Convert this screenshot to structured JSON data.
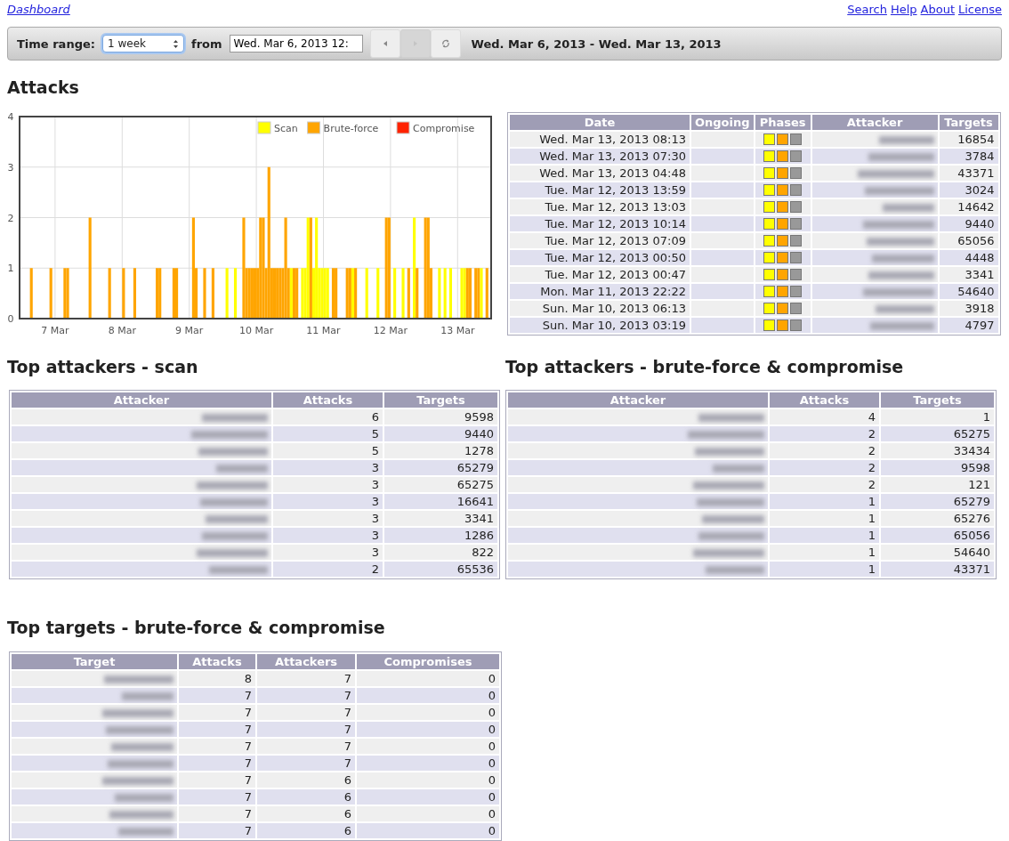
{
  "top_links": {
    "home": "Dashboard",
    "right": [
      "Search",
      "Help",
      "About",
      "License"
    ]
  },
  "toolbar": {
    "time_range_label": "Time range:",
    "time_range_value": "1 week",
    "from_label": "from",
    "from_value": "Wed. Mar 6, 2013 12:",
    "range_text": "Wed. Mar 6, 2013 - Wed. Mar 13, 2013",
    "buttons": [
      {
        "kind": "prev",
        "disabled": false
      },
      {
        "kind": "next",
        "disabled": true
      },
      {
        "kind": "refresh",
        "disabled": false
      }
    ]
  },
  "attacks": {
    "title": "Attacks",
    "chart_data": {
      "type": "bar",
      "grid": true,
      "legend": "upper right",
      "ylim": [
        0,
        4
      ],
      "yticks": [
        0,
        1,
        2,
        3,
        4
      ],
      "categories": [
        null,
        null,
        null,
        null,
        null,
        null,
        null,
        null,
        null,
        null,
        null,
        null,
        "7 Mar",
        null,
        null,
        null,
        null,
        null,
        null,
        null,
        null,
        null,
        null,
        null,
        null,
        null,
        null,
        null,
        null,
        null,
        null,
        null,
        null,
        null,
        null,
        null,
        "8 Mar",
        null,
        null,
        null,
        null,
        null,
        null,
        null,
        null,
        null,
        null,
        null,
        null,
        null,
        null,
        null,
        null,
        null,
        null,
        null,
        null,
        null,
        null,
        null,
        "9 Mar",
        null,
        null,
        null,
        null,
        null,
        null,
        null,
        null,
        null,
        null,
        null,
        null,
        null,
        null,
        null,
        null,
        null,
        null,
        null,
        null,
        null,
        null,
        null,
        "10 Mar",
        null,
        null,
        null,
        null,
        null,
        null,
        null,
        null,
        null,
        null,
        null,
        null,
        null,
        null,
        null,
        null,
        null,
        null,
        null,
        null,
        null,
        null,
        null,
        "11 Mar",
        null,
        null,
        null,
        null,
        null,
        null,
        null,
        null,
        null,
        null,
        null,
        null,
        null,
        null,
        null,
        null,
        null,
        null,
        null,
        null,
        null,
        null,
        null,
        "12 Mar",
        null,
        null,
        null,
        null,
        null,
        null,
        null,
        null,
        null,
        null,
        null,
        null,
        null,
        null,
        null,
        null,
        null,
        null,
        null,
        null,
        null,
        null,
        null,
        "13 Mar",
        null,
        null,
        null,
        null,
        null,
        null,
        null,
        null,
        null,
        null,
        null
      ],
      "series": [
        {
          "name": "Scan",
          "color": "#ffff00",
          "values": [
            0,
            0,
            0,
            0,
            0,
            0,
            0,
            0,
            0,
            0,
            0,
            0,
            0,
            0,
            0,
            0,
            0,
            0,
            0,
            0,
            0,
            0,
            0,
            0,
            0,
            0,
            0,
            0,
            0,
            0,
            0,
            0,
            0,
            0,
            0,
            0,
            0,
            0,
            0,
            0,
            0,
            0,
            0,
            0,
            0,
            0,
            0,
            0,
            0,
            0,
            0,
            0,
            0,
            0,
            0,
            0,
            0,
            0,
            0,
            0,
            0,
            0,
            0,
            0,
            0,
            0,
            0,
            0,
            0,
            0,
            0,
            0,
            0,
            1,
            0,
            0,
            1,
            0,
            0,
            0,
            0,
            0,
            0,
            0,
            0,
            0,
            0,
            0,
            0,
            0,
            0,
            0,
            0,
            0,
            0,
            0,
            1,
            0,
            0,
            0,
            1,
            1,
            2,
            0,
            1,
            2,
            1,
            1,
            1,
            1,
            0,
            0,
            0,
            0,
            0,
            0,
            0,
            0,
            1,
            0,
            0,
            0,
            0,
            1,
            0,
            0,
            0,
            1,
            0,
            0,
            0,
            0,
            0,
            1,
            0,
            0,
            1,
            0,
            0,
            0,
            2,
            0,
            0,
            0,
            0,
            0,
            0,
            0,
            0,
            1,
            0,
            1,
            0,
            1,
            0,
            0,
            0,
            1,
            1,
            0,
            0,
            0,
            0,
            0,
            1,
            0,
            0,
            0
          ]
        },
        {
          "name": "Brute-force",
          "color": "#ffa500",
          "values": [
            0,
            0,
            0,
            1,
            0,
            0,
            0,
            0,
            0,
            0,
            1,
            0,
            0,
            0,
            0,
            1,
            1,
            0,
            0,
            0,
            0,
            0,
            0,
            0,
            2,
            0,
            0,
            0,
            0,
            0,
            0,
            1,
            0,
            0,
            0,
            0,
            1,
            0,
            0,
            0,
            1,
            0,
            0,
            0,
            0,
            0,
            0,
            0,
            1,
            1,
            0,
            0,
            0,
            0,
            1,
            1,
            0,
            0,
            0,
            0,
            0,
            2,
            1,
            0,
            0,
            1,
            0,
            0,
            1,
            0,
            0,
            0,
            0,
            0,
            0,
            0,
            0,
            0,
            0,
            2,
            1,
            1,
            1,
            1,
            1,
            2,
            2,
            1,
            3,
            1,
            1,
            1,
            1,
            1,
            2,
            1,
            0,
            1,
            1,
            0,
            0,
            0,
            0,
            2,
            0,
            0,
            0,
            0,
            0,
            0,
            0,
            1,
            1,
            0,
            0,
            0,
            1,
            1,
            0,
            1,
            0,
            0,
            0,
            0,
            0,
            0,
            0,
            0,
            0,
            0,
            2,
            2,
            0,
            0,
            0,
            0,
            0,
            0,
            1,
            0,
            0,
            1,
            0,
            0,
            2,
            2,
            1,
            0,
            0,
            0,
            0,
            0,
            0,
            0,
            0,
            0,
            0,
            0,
            0,
            1,
            1,
            0,
            1,
            1,
            0,
            0,
            1,
            0
          ]
        },
        {
          "name": "Compromise",
          "color": "#ff2200",
          "values": [
            0,
            0,
            0,
            0,
            0,
            0,
            0,
            0,
            0,
            0,
            0,
            0,
            0,
            0,
            0,
            0,
            0,
            0,
            0,
            0,
            0,
            0,
            0,
            0,
            0,
            0,
            0,
            0,
            0,
            0,
            0,
            0,
            0,
            0,
            0,
            0,
            0,
            0,
            0,
            0,
            0,
            0,
            0,
            0,
            0,
            0,
            0,
            0,
            0,
            0,
            0,
            0,
            0,
            0,
            0,
            0,
            0,
            0,
            0,
            0,
            0,
            0,
            0,
            0,
            0,
            0,
            0,
            0,
            0,
            0,
            0,
            0,
            0,
            0,
            0,
            0,
            0,
            0,
            0,
            0,
            0,
            0,
            0,
            0,
            0,
            0,
            0,
            0,
            0,
            0,
            0,
            0,
            0,
            0,
            0,
            0,
            0,
            0,
            0,
            0,
            0,
            0,
            0,
            0,
            0,
            0,
            0,
            0,
            0,
            0,
            0,
            0,
            0,
            0,
            0,
            0,
            0,
            0,
            0,
            0,
            0,
            0,
            0,
            0,
            0,
            0,
            0,
            0,
            0,
            0,
            0,
            0,
            0,
            0,
            0,
            0,
            0,
            0,
            0,
            0,
            0,
            0,
            0,
            0,
            0,
            0,
            0,
            0,
            0,
            0,
            0,
            0,
            0,
            0,
            0,
            0,
            0,
            0,
            0,
            0,
            0,
            0,
            0,
            0,
            0,
            0,
            0,
            0
          ]
        }
      ]
    },
    "recent": {
      "columns": [
        "Date",
        "Ongoing",
        "Phases",
        "Attacker",
        "Targets"
      ],
      "rows": [
        {
          "date": "Wed. Mar 13, 2013 08:13",
          "phases": {
            "scan": true,
            "brute_force": true,
            "compromise": false
          },
          "targets": "16854"
        },
        {
          "date": "Wed. Mar 13, 2013 07:30",
          "phases": {
            "scan": true,
            "brute_force": true,
            "compromise": false
          },
          "targets": "3784"
        },
        {
          "date": "Wed. Mar 13, 2013 04:48",
          "phases": {
            "scan": true,
            "brute_force": true,
            "compromise": false
          },
          "targets": "43371"
        },
        {
          "date": "Tue. Mar 12, 2013 13:59",
          "phases": {
            "scan": true,
            "brute_force": true,
            "compromise": false
          },
          "targets": "3024"
        },
        {
          "date": "Tue. Mar 12, 2013 13:03",
          "phases": {
            "scan": true,
            "brute_force": true,
            "compromise": false
          },
          "targets": "14642"
        },
        {
          "date": "Tue. Mar 12, 2013 10:14",
          "phases": {
            "scan": true,
            "brute_force": true,
            "compromise": false
          },
          "targets": "9440"
        },
        {
          "date": "Tue. Mar 12, 2013 07:09",
          "phases": {
            "scan": true,
            "brute_force": true,
            "compromise": false
          },
          "targets": "65056"
        },
        {
          "date": "Tue. Mar 12, 2013 00:50",
          "phases": {
            "scan": true,
            "brute_force": true,
            "compromise": false
          },
          "targets": "4448"
        },
        {
          "date": "Tue. Mar 12, 2013 00:47",
          "phases": {
            "scan": true,
            "brute_force": true,
            "compromise": false
          },
          "targets": "3341"
        },
        {
          "date": "Mon. Mar 11, 2013 22:22",
          "phases": {
            "scan": true,
            "brute_force": true,
            "compromise": false
          },
          "targets": "54640"
        },
        {
          "date": "Sun. Mar 10, 2013 06:13",
          "phases": {
            "scan": true,
            "brute_force": true,
            "compromise": false
          },
          "targets": "3918"
        },
        {
          "date": "Sun. Mar 10, 2013 03:19",
          "phases": {
            "scan": true,
            "brute_force": true,
            "compromise": false
          },
          "targets": "4797"
        }
      ]
    }
  },
  "top_scan": {
    "title": "Top attackers - scan",
    "columns": [
      "Attacker",
      "Attacks",
      "Targets"
    ],
    "rows": [
      {
        "attacks": "6",
        "targets": "9598"
      },
      {
        "attacks": "5",
        "targets": "9440"
      },
      {
        "attacks": "5",
        "targets": "1278"
      },
      {
        "attacks": "3",
        "targets": "65279"
      },
      {
        "attacks": "3",
        "targets": "65275"
      },
      {
        "attacks": "3",
        "targets": "16641"
      },
      {
        "attacks": "3",
        "targets": "3341"
      },
      {
        "attacks": "3",
        "targets": "1286"
      },
      {
        "attacks": "3",
        "targets": "822"
      },
      {
        "attacks": "2",
        "targets": "65536"
      }
    ]
  },
  "top_bruteforce": {
    "title": "Top attackers - brute-force & compromise",
    "columns": [
      "Attacker",
      "Attacks",
      "Targets"
    ],
    "rows": [
      {
        "attacks": "4",
        "targets": "1"
      },
      {
        "attacks": "2",
        "targets": "65275"
      },
      {
        "attacks": "2",
        "targets": "33434"
      },
      {
        "attacks": "2",
        "targets": "9598"
      },
      {
        "attacks": "2",
        "targets": "121"
      },
      {
        "attacks": "1",
        "targets": "65279"
      },
      {
        "attacks": "1",
        "targets": "65276"
      },
      {
        "attacks": "1",
        "targets": "65056"
      },
      {
        "attacks": "1",
        "targets": "54640"
      },
      {
        "attacks": "1",
        "targets": "43371"
      }
    ]
  },
  "top_targets": {
    "title": "Top targets - brute-force & compromise",
    "columns": [
      "Target",
      "Attacks",
      "Attackers",
      "Compromises"
    ],
    "rows": [
      {
        "attacks": "8",
        "attackers": "7",
        "compromises": "0"
      },
      {
        "attacks": "7",
        "attackers": "7",
        "compromises": "0"
      },
      {
        "attacks": "7",
        "attackers": "7",
        "compromises": "0"
      },
      {
        "attacks": "7",
        "attackers": "7",
        "compromises": "0"
      },
      {
        "attacks": "7",
        "attackers": "7",
        "compromises": "0"
      },
      {
        "attacks": "7",
        "attackers": "7",
        "compromises": "0"
      },
      {
        "attacks": "7",
        "attackers": "6",
        "compromises": "0"
      },
      {
        "attacks": "7",
        "attackers": "6",
        "compromises": "0"
      },
      {
        "attacks": "7",
        "attackers": "6",
        "compromises": "0"
      },
      {
        "attacks": "7",
        "attackers": "6",
        "compromises": "0"
      }
    ]
  }
}
